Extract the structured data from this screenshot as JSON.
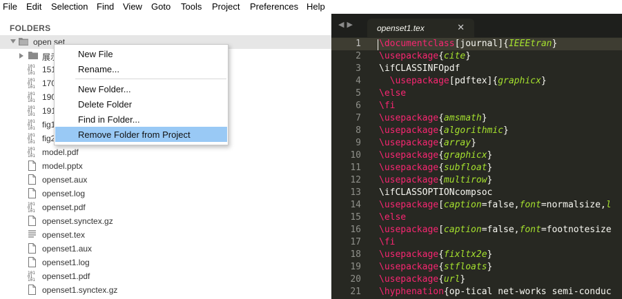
{
  "menubar": [
    "File",
    "Edit",
    "Selection",
    "Find",
    "View",
    "Goto",
    "Tools",
    "Project",
    "Preferences",
    "Help"
  ],
  "sidebar": {
    "header": "FOLDERS",
    "root_folder": "open set",
    "items": [
      {
        "label": "展示",
        "icon": "folder-icon"
      },
      {
        "label": "151",
        "icon": "binary-file-icon"
      },
      {
        "label": "170",
        "icon": "binary-file-icon"
      },
      {
        "label": "190",
        "icon": "binary-file-icon"
      },
      {
        "label": "191",
        "icon": "binary-file-icon"
      },
      {
        "label": "fig1",
        "icon": "binary-file-icon"
      },
      {
        "label": "fig2",
        "icon": "binary-file-icon"
      },
      {
        "label": "model.pdf",
        "icon": "binary-file-icon"
      },
      {
        "label": "model.pptx",
        "icon": "file-icon"
      },
      {
        "label": "openset.aux",
        "icon": "file-icon"
      },
      {
        "label": "openset.log",
        "icon": "file-icon"
      },
      {
        "label": "openset.pdf",
        "icon": "binary-file-icon"
      },
      {
        "label": "openset.synctex.gz",
        "icon": "file-icon"
      },
      {
        "label": "openset.tex",
        "icon": "text-file-icon"
      },
      {
        "label": "openset1.aux",
        "icon": "file-icon"
      },
      {
        "label": "openset1.log",
        "icon": "file-icon"
      },
      {
        "label": "openset1.pdf",
        "icon": "binary-file-icon"
      },
      {
        "label": "openset1.synctex.gz",
        "icon": "file-icon"
      }
    ]
  },
  "context_menu": {
    "items": [
      "New File",
      "Rename...",
      "New Folder...",
      "Delete Folder",
      "Find in Folder...",
      "Remove Folder from Project"
    ],
    "highlighted": "Remove Folder from Project"
  },
  "editor": {
    "tab_title": "openset1.tex",
    "current_line": 1,
    "lines": [
      [
        [
          "k",
          "\\documentclass"
        ],
        [
          "p",
          "[journal]{"
        ],
        [
          "a",
          "IEEEtran"
        ],
        [
          "p",
          "}"
        ]
      ],
      [
        [
          "k",
          "\\usepackage"
        ],
        [
          "p",
          "{"
        ],
        [
          "a",
          "cite"
        ],
        [
          "p",
          "}"
        ]
      ],
      [
        [
          "p",
          "\\ifCLASSINFOpdf"
        ]
      ],
      [
        [
          "p",
          "  "
        ],
        [
          "k",
          "\\usepackage"
        ],
        [
          "p",
          "[pdftex]{"
        ],
        [
          "a",
          "graphicx"
        ],
        [
          "p",
          "}"
        ]
      ],
      [
        [
          "k",
          "\\else"
        ]
      ],
      [
        [
          "k",
          "\\fi"
        ]
      ],
      [
        [
          "k",
          "\\usepackage"
        ],
        [
          "p",
          "{"
        ],
        [
          "a",
          "amsmath"
        ],
        [
          "p",
          "}"
        ]
      ],
      [
        [
          "k",
          "\\usepackage"
        ],
        [
          "p",
          "{"
        ],
        [
          "a",
          "algorithmic"
        ],
        [
          "p",
          "}"
        ]
      ],
      [
        [
          "k",
          "\\usepackage"
        ],
        [
          "p",
          "{"
        ],
        [
          "a",
          "array"
        ],
        [
          "p",
          "}"
        ]
      ],
      [
        [
          "k",
          "\\usepackage"
        ],
        [
          "p",
          "{"
        ],
        [
          "a",
          "graphicx"
        ],
        [
          "p",
          "}"
        ]
      ],
      [
        [
          "k",
          "\\usepackage"
        ],
        [
          "p",
          "{"
        ],
        [
          "a",
          "subfloat"
        ],
        [
          "p",
          "}"
        ]
      ],
      [
        [
          "k",
          "\\usepackage"
        ],
        [
          "p",
          "{"
        ],
        [
          "a",
          "multirow"
        ],
        [
          "p",
          "}"
        ]
      ],
      [
        [
          "p",
          "\\ifCLASSOPTIONcompsoc"
        ]
      ],
      [
        [
          "k",
          "\\usepackage"
        ],
        [
          "p",
          "["
        ],
        [
          "a",
          "caption"
        ],
        [
          "p",
          "=false,"
        ],
        [
          "a",
          "font"
        ],
        [
          "p",
          "=normalsize,"
        ],
        [
          "a",
          "l"
        ]
      ],
      [
        [
          "k",
          "\\else"
        ]
      ],
      [
        [
          "k",
          "\\usepackage"
        ],
        [
          "p",
          "["
        ],
        [
          "a",
          "caption"
        ],
        [
          "p",
          "=false,"
        ],
        [
          "a",
          "font"
        ],
        [
          "p",
          "=footnotesize"
        ]
      ],
      [
        [
          "k",
          "\\fi"
        ]
      ],
      [
        [
          "k",
          "\\usepackage"
        ],
        [
          "p",
          "{"
        ],
        [
          "a",
          "fixltx2e"
        ],
        [
          "p",
          "}"
        ]
      ],
      [
        [
          "k",
          "\\usepackage"
        ],
        [
          "p",
          "{"
        ],
        [
          "a",
          "stfloats"
        ],
        [
          "p",
          "}"
        ]
      ],
      [
        [
          "k",
          "\\usepackage"
        ],
        [
          "p",
          "{"
        ],
        [
          "a",
          "url"
        ],
        [
          "p",
          "}"
        ]
      ],
      [
        [
          "k",
          "\\hyphenation"
        ],
        [
          "p",
          "{op-tical net-works semi-conduc"
        ]
      ]
    ]
  }
}
